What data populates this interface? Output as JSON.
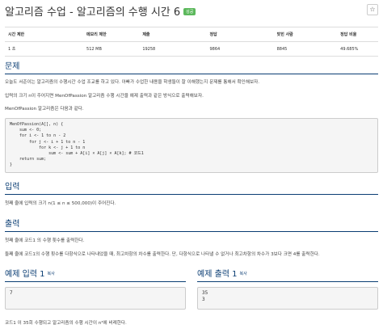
{
  "header": {
    "title": "알고리즘 수업 - 알고리즘의 수행 시간 6",
    "badge": "성공",
    "star_label": "☆"
  },
  "info_table": {
    "headers": [
      "시간 제한",
      "메모리 제한",
      "제출",
      "정답",
      "맞힌 사람",
      "정답 비율"
    ],
    "row": [
      "1 초",
      "512 MB",
      "19258",
      "9864",
      "8845",
      "49.685%"
    ]
  },
  "problem": {
    "heading": "문제",
    "lines": [
      "오늘도 서준이는 알고리즘의 수행시간 수업 조교를 하고 있다. 아빠가 수업한 내용을 학생들이 잘 이해했는지 문제를 통해서 확인해보자.",
      "입력의 크기 n이 주어지면 MenOfPassion 알고리즘 수행 시간을 예제 출력과 같은 방식으로 출력해보자.",
      "MenOfPassion 알고리즘은 다음과 같다."
    ],
    "code": "MenOfPassion(A[], n) {\n    sum <- 0;\n    for i <- 1 to n - 2\n        for j <- i + 1 to n - 1\n            for k <- j + 1 to n\n                sum <- sum + A[i] × A[j] × A[k]; # 코드1\n    return sum;\n}"
  },
  "input": {
    "heading": "입력",
    "text": "첫째 줄에 입력의 크기 n(1 ≤ n ≤ 500,000)이 주어진다."
  },
  "output": {
    "heading": "출력",
    "lines": [
      "첫째 줄에 코드1 의 수행 횟수를 출력한다.",
      "둘째 줄에 코드1의 수행 횟수를 다항식으로 나타내었을 때, 최고차항의 차수를 출력한다. 단, 다항식으로 나타낼 수 없거나 최고차항의 차수가 3보다 크면 4를 출력한다."
    ]
  },
  "sample_input": {
    "heading": "예제 입력 1",
    "copy": "복사",
    "lines": [
      "7"
    ]
  },
  "sample_output": {
    "heading": "예제 출력 1",
    "copy": "복사",
    "lines": [
      "35",
      "3"
    ]
  },
  "footer_text": "코드1 이 35회 수행되고 알고리즘의 수행 시간이 n³에 비례한다."
}
